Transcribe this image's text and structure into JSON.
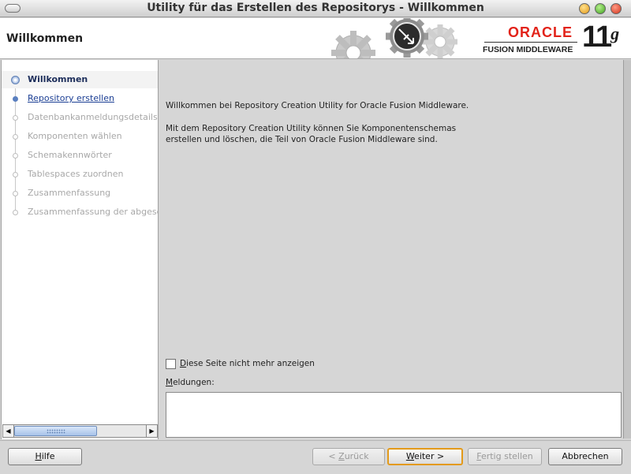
{
  "window": {
    "title": "Utility für das Erstellen des Repositorys - Willkommen"
  },
  "header": {
    "title": "Willkommen",
    "brand": "ORACLE",
    "brand_sub": "FUSION MIDDLEWARE",
    "version_num": "11",
    "version_letter": "g"
  },
  "nav": {
    "items": [
      {
        "label": "Willkommen",
        "state": "active"
      },
      {
        "label": "Repository erstellen",
        "state": "next"
      },
      {
        "label": "Datenbankanmeldungsdetails",
        "state": "pending"
      },
      {
        "label": "Komponenten wählen",
        "state": "pending"
      },
      {
        "label": "Schemakennwörter",
        "state": "pending"
      },
      {
        "label": "Tablespaces zuordnen",
        "state": "pending"
      },
      {
        "label": "Zusammenfassung",
        "state": "pending"
      },
      {
        "label": "Zusammenfassung der abgesc",
        "state": "pending"
      }
    ],
    "scroll_left": "◀",
    "scroll_right": "▶"
  },
  "main": {
    "welcome_text": "Willkommen bei Repository Creation Utility for Oracle Fusion Middleware.",
    "description_line1": "Mit dem Repository Creation Utility können Sie Komponentenschemas",
    "description_line2": "erstellen und löschen, die Teil von Oracle Fusion Middleware sind.",
    "checkbox_first": "D",
    "checkbox_rest": "iese Seite nicht mehr anzeigen",
    "checkbox_checked": false,
    "messages_first": "M",
    "messages_rest": "eldungen:"
  },
  "footer": {
    "help_first": "H",
    "help_rest": "ilfe",
    "back_prefix": "< ",
    "back_first": "Z",
    "back_rest": "urück",
    "next_first": "W",
    "next_rest": "eiter >",
    "finish_first": "F",
    "finish_rest": "ertig stellen",
    "cancel_label": "Abbrechen"
  },
  "colors": {
    "brand_red": "#e2231a",
    "nav_link": "#1c3f94",
    "default_button_outline": "#e39a1a"
  }
}
